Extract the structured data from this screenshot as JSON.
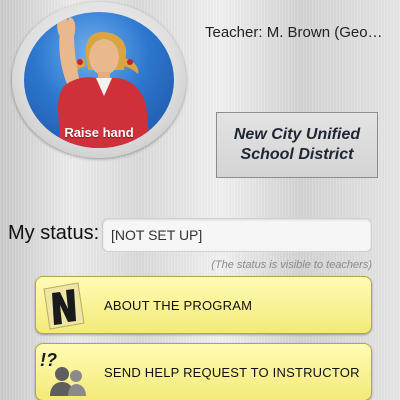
{
  "raise_hand": {
    "label": "Raise hand"
  },
  "teacher": {
    "text": "Teacher: M. Brown (Geo…"
  },
  "district": {
    "line1": "New City Unified",
    "line2": "School District"
  },
  "status": {
    "label": "My status:",
    "value": "[NOT SET UP]",
    "hint": "(The status is visible to teachers)"
  },
  "buttons": [
    {
      "label": "ABOUT THE PROGRAM",
      "icon": "program-logo-icon"
    },
    {
      "label": "SEND HELP REQUEST TO INSTRUCTOR",
      "icon": "help-request-icon"
    }
  ],
  "colors": {
    "raise_hand_blue": "#2d77cf",
    "button_yellow": "#f7f092",
    "district_text": "#1e2633"
  }
}
